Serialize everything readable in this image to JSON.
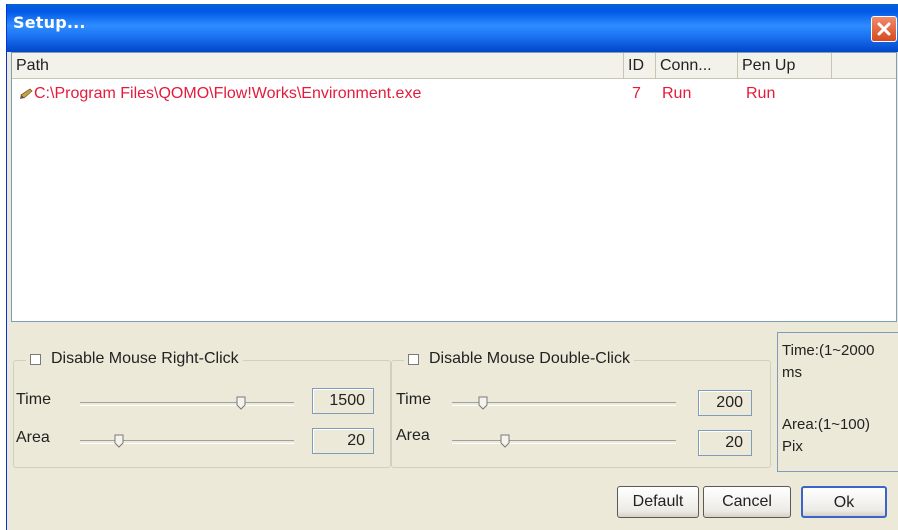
{
  "window": {
    "title": "Setup..."
  },
  "list": {
    "columns": [
      "Path",
      "ID",
      "Conn...",
      "Pen Up"
    ],
    "rows": [
      {
        "path": "C:\\Program Files\\QOMO\\Flow!Works\\Environment.exe",
        "id": "7",
        "conn": "Run",
        "pen_up": "Run"
      }
    ],
    "row_color": "#e41b3a"
  },
  "right_click": {
    "label": "Disable Mouse Right-Click",
    "checked": false,
    "time_label": "Time",
    "time_value": "1500",
    "area_label": "Area",
    "area_value": "20"
  },
  "double_click": {
    "label": "Disable Mouse Double-Click",
    "checked": false,
    "time_label": "Time",
    "time_value": "200",
    "area_label": "Area",
    "area_value": "20"
  },
  "info": {
    "time_range": "Time:(1~2000",
    "time_unit": "ms",
    "area_range": "Area:(1~100)",
    "area_unit": "Pix"
  },
  "buttons": {
    "default": "Default",
    "cancel": "Cancel",
    "ok": "Ok"
  },
  "icons": {
    "close": "close-icon",
    "row": "pen-icon"
  }
}
